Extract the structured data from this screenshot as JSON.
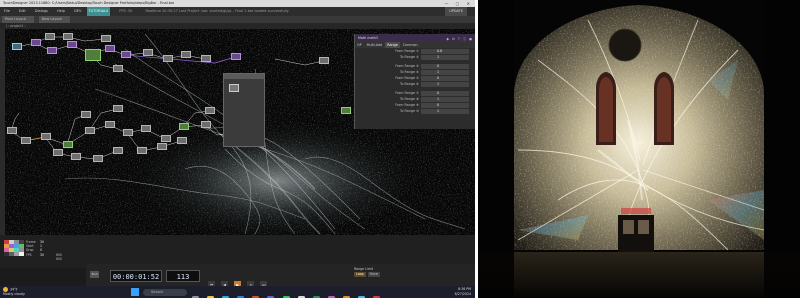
{
  "td_window": {
    "title": "TouchDesigner 2023.11880: C:/Users/Nakul/Desktop/Touch Designer Portfolio/steps/BigBar - Final.toe",
    "controls": "—  ▢  ✕",
    "menu": [
      "File",
      "Edit",
      "Dialogs",
      "Help",
      "DEV"
    ],
    "menu_tag": "TUTORIALS",
    "menu_status_fps": "FPS: 30",
    "menu_status_msg": "Realtime  20:30:27 Last Project .toe: started/gl/gL - Final 2.toe loaded successfully",
    "update_label": "UPDATE",
    "toolbar": [
      "Pane Layout",
      "New Layout"
    ],
    "path": "/ › project1 ›"
  },
  "params_panel": {
    "title": "Math  math3",
    "icons": "◆ ⚙ ? ⓘ ●",
    "tabs": [
      "OP",
      "Multi-Add",
      "Range",
      "Common"
    ],
    "active_tab": "Range",
    "rows": [
      {
        "label": "From Range ①",
        "value": "0.8"
      },
      {
        "label": "To Range ②",
        "value": "1"
      },
      {
        "label": "",
        "value": ""
      },
      {
        "label": "From Range ③",
        "value": "0"
      },
      {
        "label": "To Range ④",
        "value": "1"
      },
      {
        "label": "From Range ⑤",
        "value": "0"
      },
      {
        "label": "To Range ⑥",
        "value": "1"
      },
      {
        "label": "",
        "value": ""
      },
      {
        "label": "From Range ⑦",
        "value": "0"
      },
      {
        "label": "To Range ⑧",
        "value": "1"
      },
      {
        "label": "From Range ⑨",
        "value": "0"
      },
      {
        "label": "To Range ⑩",
        "value": "1"
      }
    ]
  },
  "perf": {
    "rows": [
      {
        "k": "Frame",
        "v": "30"
      },
      {
        "k": "Start",
        "v": "1"
      },
      {
        "k": "Drop",
        "v": "0"
      },
      {
        "k": "FPS",
        "v": "30"
      }
    ],
    "col2": [
      "600",
      "600",
      "600"
    ],
    "note": "Show"
  },
  "transport": {
    "timecode": "00:00:01:52",
    "frame": "113",
    "range_label": "Range Limit",
    "range_btn_on": "Loop",
    "range_btn_off": "Once",
    "buttons": [
      "⏮",
      "◀",
      "▶",
      "⏸",
      "⏭"
    ],
    "play_active": "▶",
    "end_label": "End"
  },
  "taskbar": {
    "weather_temp": "34°F",
    "weather_desc": "Mostly cloudy",
    "search_placeholder": "Search",
    "time": "8:36 PM",
    "date": "6/27/2024"
  },
  "colors": {
    "accent_play": "#d07a2a",
    "windows_blue": "#3aa0ff"
  }
}
